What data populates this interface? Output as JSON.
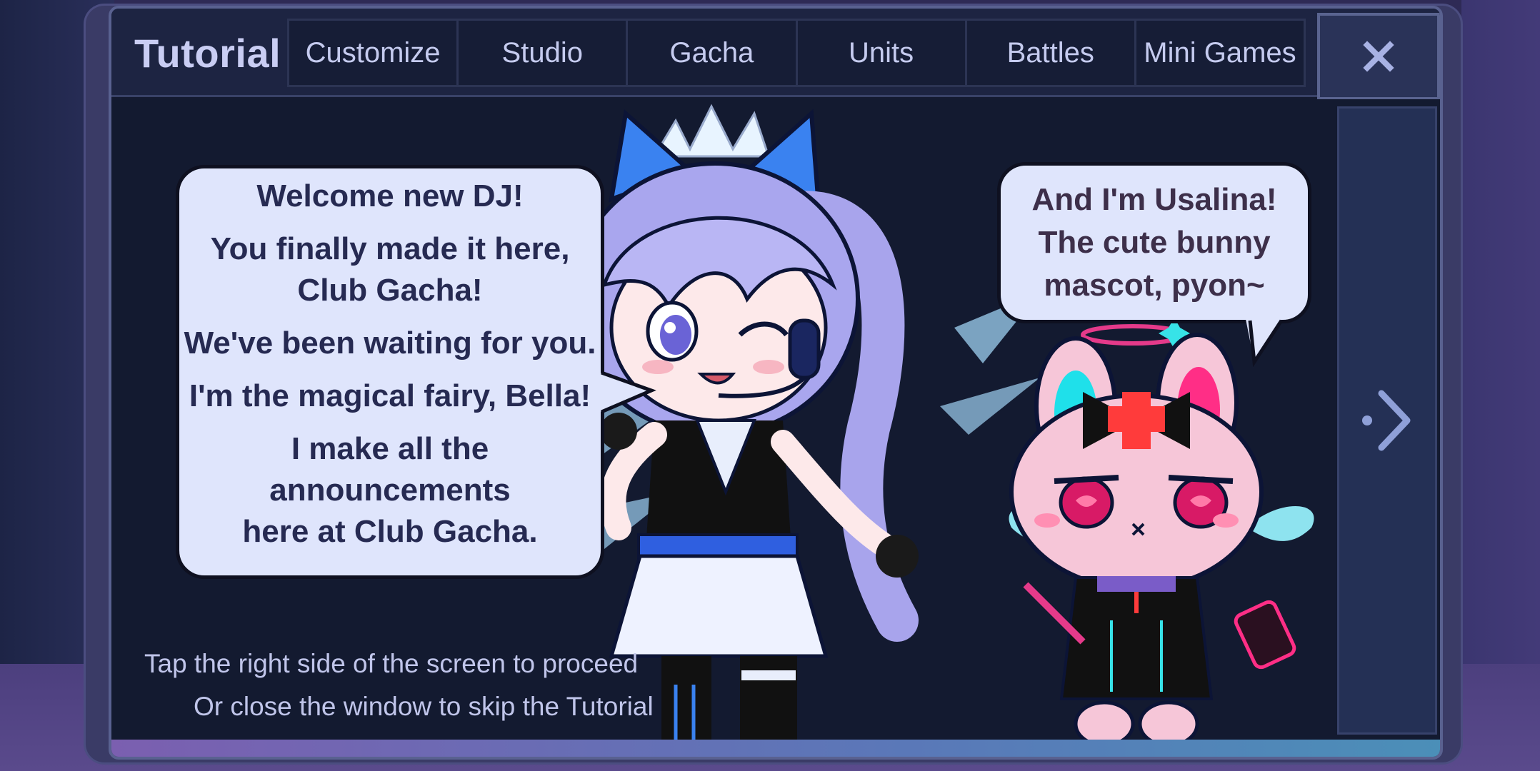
{
  "header": {
    "title": "Tutorial",
    "tabs": [
      "Customize",
      "Studio",
      "Gacha",
      "Units",
      "Battles",
      "Mini Games"
    ],
    "close_icon": "close-x-icon"
  },
  "dialogue": {
    "bella": {
      "lines": [
        "Welcome new DJ!",
        "You finally made it here,",
        "Club Gacha!",
        "We've been waiting for you.",
        "I'm the magical fairy, Bella!",
        "I make all the announcements",
        "here at Club Gacha."
      ]
    },
    "usalina": {
      "lines": [
        "And I'm Usalina!",
        "The cute bunny",
        "mascot, pyon~"
      ]
    }
  },
  "hints": {
    "line1": "Tap the right side of the screen to proceed",
    "line2": "Or close the window to skip the Tutorial"
  },
  "icons": {
    "next": "chevron-right-icon",
    "close": "close-x-icon"
  },
  "colors": {
    "window_bg": "#141a31",
    "header_bg": "#1d2442",
    "bubble_bg": "#dfe5fc",
    "text_dark": "#262a52",
    "accent_blue": "#3a6cf0",
    "bunny_pink": "#f6c6d8"
  }
}
